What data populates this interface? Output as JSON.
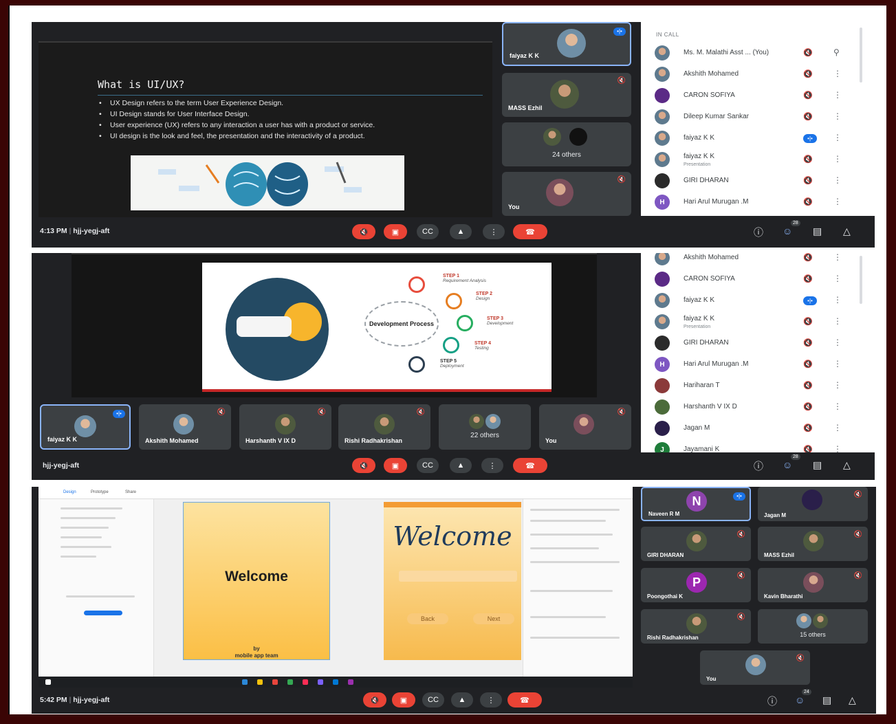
{
  "panel1": {
    "slide": {
      "title": "What is UI/UX?",
      "bullets": [
        "UX Design refers to the term User Experience Design.",
        "UI Design stands for User Interface Design.",
        "User experience (UX) refers to any interaction a user has with a product or service.",
        "UI design is the look and feel, the presentation and the interactivity of a product."
      ]
    },
    "tiles": [
      {
        "name": "faiyaz K K",
        "state": "speaking"
      },
      {
        "name": "MASS Ezhil",
        "state": "muted"
      },
      {
        "name": "24 others",
        "state": "group"
      },
      {
        "name": "You",
        "state": "muted"
      }
    ],
    "people": {
      "header": "IN CALL",
      "rows": [
        {
          "name": "Ms. M. Malathi Asst ...  (You)",
          "sub": "",
          "mic": "muted",
          "action": "pin"
        },
        {
          "name": "Akshith Mohamed",
          "sub": "",
          "mic": "muted",
          "action": "more"
        },
        {
          "name": "CARON SOFIYA",
          "sub": "",
          "mic": "muted",
          "action": "more"
        },
        {
          "name": "Dileep Kumar Sankar",
          "sub": "",
          "mic": "muted",
          "action": "more"
        },
        {
          "name": "faiyaz K K",
          "sub": "",
          "mic": "speaking",
          "action": "more"
        },
        {
          "name": "faiyaz K K",
          "sub": "Presentation",
          "mic": "muted",
          "action": "more"
        },
        {
          "name": "GIRI DHARAN",
          "sub": "",
          "mic": "muted",
          "action": "more"
        },
        {
          "name": "Hari Arul Murugan .M",
          "sub": "",
          "mic": "muted",
          "action": "more",
          "letter": "H"
        }
      ]
    },
    "bar": {
      "time": "4:13 PM",
      "separator": "|",
      "code": "hjj-yegj-aft",
      "people_count": "28"
    }
  },
  "panel2": {
    "slide": {
      "center": "Development Process",
      "steps": [
        {
          "label": "STEP 1",
          "sub": "Requirement Analysis"
        },
        {
          "label": "STEP 2",
          "sub": "Design"
        },
        {
          "label": "STEP 3",
          "sub": "Development"
        },
        {
          "label": "STEP 4",
          "sub": "Testing"
        },
        {
          "label": "STEP 5",
          "sub": "Deployment"
        }
      ]
    },
    "tiles": [
      {
        "name": "faiyaz K K",
        "state": "speaking"
      },
      {
        "name": "Akshith Mohamed",
        "state": "muted"
      },
      {
        "name": "Harshanth V IX D",
        "state": "muted"
      },
      {
        "name": "Rishi Radhakrishan",
        "state": "muted"
      },
      {
        "name": "22 others",
        "state": "group"
      },
      {
        "name": "You",
        "state": "muted"
      }
    ],
    "people": {
      "rows": [
        {
          "name": "Akshith Mohamed",
          "sub": "",
          "mic": "muted"
        },
        {
          "name": "CARON SOFIYA",
          "sub": "",
          "mic": "muted"
        },
        {
          "name": "faiyaz K K",
          "sub": "",
          "mic": "speaking"
        },
        {
          "name": "faiyaz K K",
          "sub": "Presentation",
          "mic": "muted"
        },
        {
          "name": "GIRI DHARAN",
          "sub": "",
          "mic": "muted"
        },
        {
          "name": "Hari Arul Murugan .M",
          "sub": "",
          "mic": "muted",
          "letter": "H"
        },
        {
          "name": "Hariharan T",
          "sub": "",
          "mic": "muted"
        },
        {
          "name": "Harshanth V IX D",
          "sub": "",
          "mic": "muted"
        },
        {
          "name": "Jagan M",
          "sub": "",
          "mic": "muted"
        },
        {
          "name": "Jayamani K",
          "sub": "",
          "mic": "muted",
          "letter": "J"
        }
      ]
    },
    "bar": {
      "code": "hjj-yegj-aft",
      "people_count": "28"
    }
  },
  "panel3": {
    "design": {
      "tabs": [
        "Design",
        "Prototype",
        "Share"
      ],
      "artboard1": {
        "title": "Welcome",
        "byline": "by",
        "team": "mobile app team"
      },
      "artboard2": {
        "script": "Welcome",
        "back": "Back",
        "next": "Next"
      }
    },
    "tiles": [
      {
        "name": "Naveen R M",
        "letter": "N",
        "state": "speaking"
      },
      {
        "name": "Jagan M",
        "state": "muted"
      },
      {
        "name": "GIRI DHARAN",
        "state": "muted"
      },
      {
        "name": "MASS Ezhil",
        "state": "muted"
      },
      {
        "name": "Poongothai K",
        "letter": "P",
        "state": "muted"
      },
      {
        "name": "Kavin Bharathi",
        "state": "muted"
      },
      {
        "name": "Rishi Radhakrishan",
        "state": "muted"
      },
      {
        "name": "15 others",
        "state": "group"
      },
      {
        "name": "You",
        "state": "muted"
      }
    ],
    "bar": {
      "time": "5:42 PM",
      "separator": "|",
      "code": "hjj-yegj-aft",
      "people_count": "24"
    }
  },
  "icons": {
    "mic_off": "mic-off-icon",
    "cam_off": "camera-off-icon",
    "captions": "captions-icon",
    "present": "present-icon",
    "more": "more-vert-icon",
    "end_call": "end-call-icon",
    "info": "info-icon",
    "people": "people-icon",
    "chat": "chat-icon",
    "activities": "activities-icon"
  },
  "colors": {
    "end_call": "#ea4335",
    "speaking": "#1a73e8",
    "meet_bg": "#202124",
    "tile_bg": "#3c4043"
  }
}
